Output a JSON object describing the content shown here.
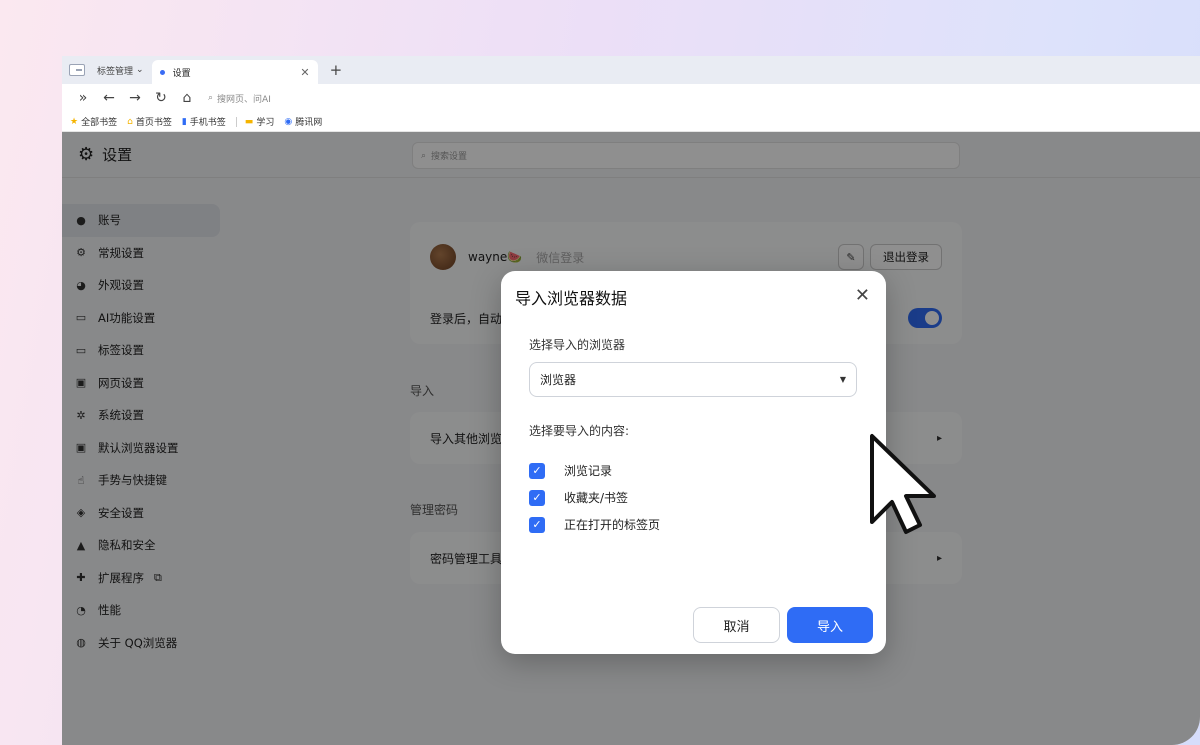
{
  "tabbar": {
    "group_label": "标签管理",
    "active_tab_title": "设置"
  },
  "toolbar": {
    "search_placeholder": "搜网页、问AI"
  },
  "bookmarks": [
    {
      "label": "全部书签",
      "icon": "star-icon"
    },
    {
      "label": "首页书签",
      "icon": "home-bookmark-icon"
    },
    {
      "label": "手机书签",
      "icon": "phone-icon"
    },
    {
      "label": "学习",
      "icon": "folder-icon"
    },
    {
      "label": "腾讯网",
      "icon": "tencent-icon"
    }
  ],
  "settings": {
    "title": "设置",
    "search_placeholder": "搜索设置",
    "sidebar": [
      {
        "label": "账号",
        "icon": "user-icon"
      },
      {
        "label": "常规设置",
        "icon": "gear-icon"
      },
      {
        "label": "外观设置",
        "icon": "palette-icon"
      },
      {
        "label": "AI功能设置",
        "icon": "window-icon"
      },
      {
        "label": "标签设置",
        "icon": "tab-icon"
      },
      {
        "label": "网页设置",
        "icon": "webpage-icon"
      },
      {
        "label": "系统设置",
        "icon": "system-icon"
      },
      {
        "label": "默认浏览器设置",
        "icon": "browser-icon"
      },
      {
        "label": "手势与快捷键",
        "icon": "hand-icon"
      },
      {
        "label": "安全设置",
        "icon": "shield-icon"
      },
      {
        "label": "隐私和安全",
        "icon": "lock-icon"
      },
      {
        "label": "扩展程序",
        "icon": "puzzle-icon"
      },
      {
        "label": "性能",
        "icon": "gauge-icon"
      },
      {
        "label": "关于 QQ浏览器",
        "icon": "qq-browser-icon"
      }
    ],
    "account": {
      "user_name": "wayne🍉",
      "login_method": "微信登录",
      "logout_label": "退出登录",
      "sync_row_label": "登录后，自动"
    },
    "import_section_label": "导入",
    "import_row_label": "导入其他浏览",
    "password_section_label": "管理密码",
    "password_row_label": "密码管理工具"
  },
  "modal": {
    "title": "导入浏览器数据",
    "browser_label": "选择导入的浏览器",
    "browser_selected": "浏览器",
    "content_label": "选择要导入的内容:",
    "options": [
      {
        "label": "浏览记录",
        "checked": true
      },
      {
        "label": "收藏夹/书签",
        "checked": true
      },
      {
        "label": "正在打开的标签页",
        "checked": true
      }
    ],
    "cancel_label": "取消",
    "import_label": "导入"
  },
  "colors": {
    "accent": "#2f6cf5"
  }
}
